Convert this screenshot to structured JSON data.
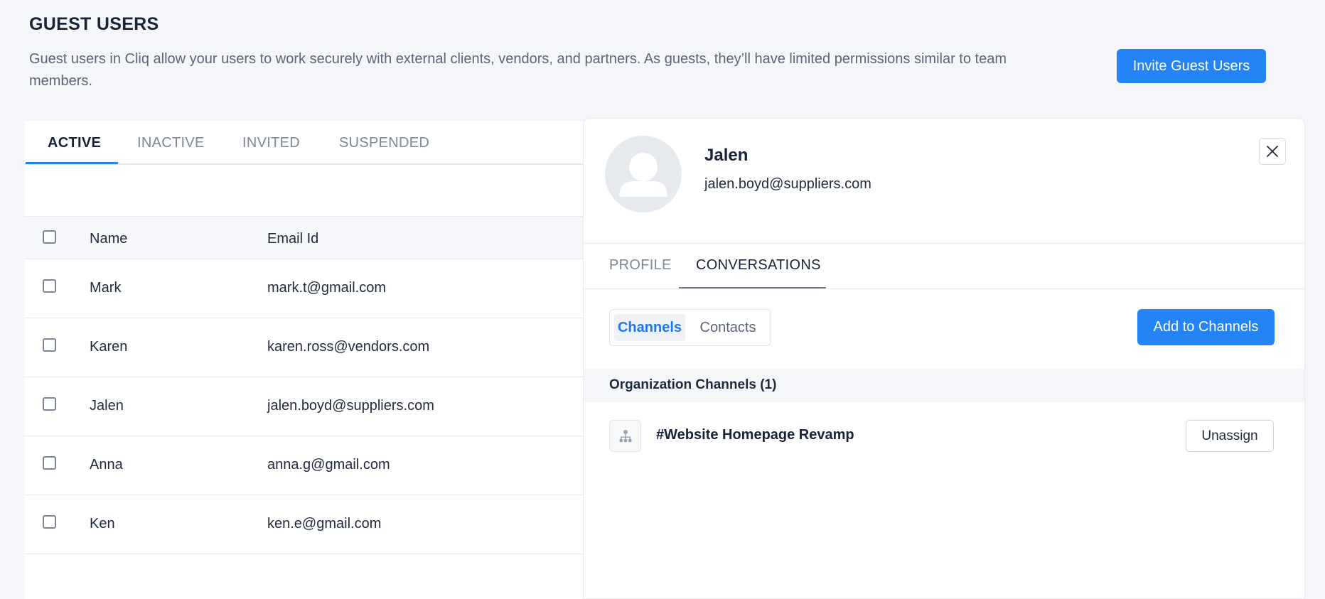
{
  "header": {
    "title": "GUEST USERS",
    "description": "Guest users in Cliq allow your users to work securely with external clients, vendors, and partners. As guests, they’ll have limited permissions similar to team members.",
    "invite_button": "Invite Guest Users"
  },
  "tabs": [
    {
      "label": "ACTIVE",
      "active": true
    },
    {
      "label": "INACTIVE",
      "active": false
    },
    {
      "label": "INVITED",
      "active": false
    },
    {
      "label": "SUSPENDED",
      "active": false
    }
  ],
  "table": {
    "columns": [
      "Name",
      "Email Id"
    ],
    "rows": [
      {
        "name": "Mark",
        "email": "mark.t@gmail.com"
      },
      {
        "name": "Karen",
        "email": "karen.ross@vendors.com"
      },
      {
        "name": "Jalen",
        "email": "jalen.boyd@suppliers.com"
      },
      {
        "name": "Anna",
        "email": "anna.g@gmail.com"
      },
      {
        "name": "Ken",
        "email": "ken.e@gmail.com"
      }
    ]
  },
  "detail": {
    "name": "Jalen",
    "email": "jalen.boyd@suppliers.com",
    "tabs": [
      {
        "label": "PROFILE",
        "active": false
      },
      {
        "label": "CONVERSATIONS",
        "active": true
      }
    ],
    "segments": [
      {
        "label": "Channels",
        "active": true
      },
      {
        "label": "Contacts",
        "active": false
      }
    ],
    "add_button": "Add to Channels",
    "section_title": "Organization Channels (1)",
    "channels": [
      {
        "name": "#Website Homepage Revamp",
        "action": "Unassign"
      }
    ]
  },
  "colors": {
    "accent": "#2483f5",
    "background": "#f4f6f9",
    "text_primary": "#16233a",
    "text_muted": "#7c8797"
  },
  "icons": {
    "avatar": "user-avatar-icon",
    "close": "close-icon",
    "channel": "org-hierarchy-icon"
  }
}
